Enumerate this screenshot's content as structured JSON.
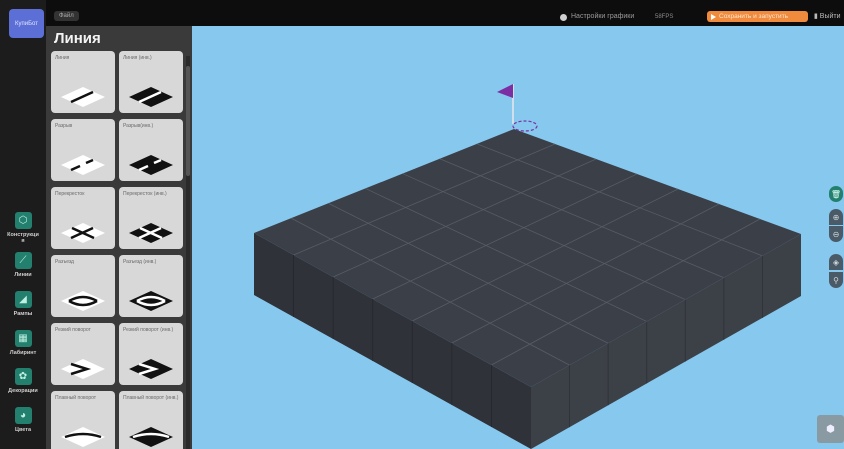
{
  "app": {
    "logo_text": "КупиБот"
  },
  "topbar": {
    "file_label": "Файл",
    "graphics_label": "Настройки графики",
    "fps_label": "58FPS",
    "save_run_label": "Сохранить и запустить",
    "exit_label": "Выйти"
  },
  "rail": {
    "items": [
      {
        "label": "Конструкци\nя",
        "icon": "box-icon"
      },
      {
        "label": "Линии",
        "icon": "line-icon"
      },
      {
        "label": "Рампы",
        "icon": "ramp-icon"
      },
      {
        "label": "Лабиринт",
        "icon": "maze-icon"
      },
      {
        "label": "Декорации",
        "icon": "flower-icon"
      },
      {
        "label": "Цвета",
        "icon": "palette-icon"
      }
    ]
  },
  "panel": {
    "title": "Линия",
    "tiles": [
      {
        "label": "Линия"
      },
      {
        "label": "Линия (инв.)"
      },
      {
        "label": "Разрыв"
      },
      {
        "label": "Разрыв(инв.)"
      },
      {
        "label": "Перекресток"
      },
      {
        "label": "Перекресток (инв.)"
      },
      {
        "label": "Разъезд"
      },
      {
        "label": "Разъезд (инв.)"
      },
      {
        "label": "Резкий поворот"
      },
      {
        "label": "Резкий поворот (инв.)"
      },
      {
        "label": "Плавный поворот"
      },
      {
        "label": "Плавный поворот (инв.)"
      }
    ]
  },
  "colors": {
    "sky": "#87c8ef",
    "accent_green": "#23806f",
    "save_orange": "#f08a3c",
    "field_top": "#3b3f47",
    "flag": "#7b2fa3"
  }
}
